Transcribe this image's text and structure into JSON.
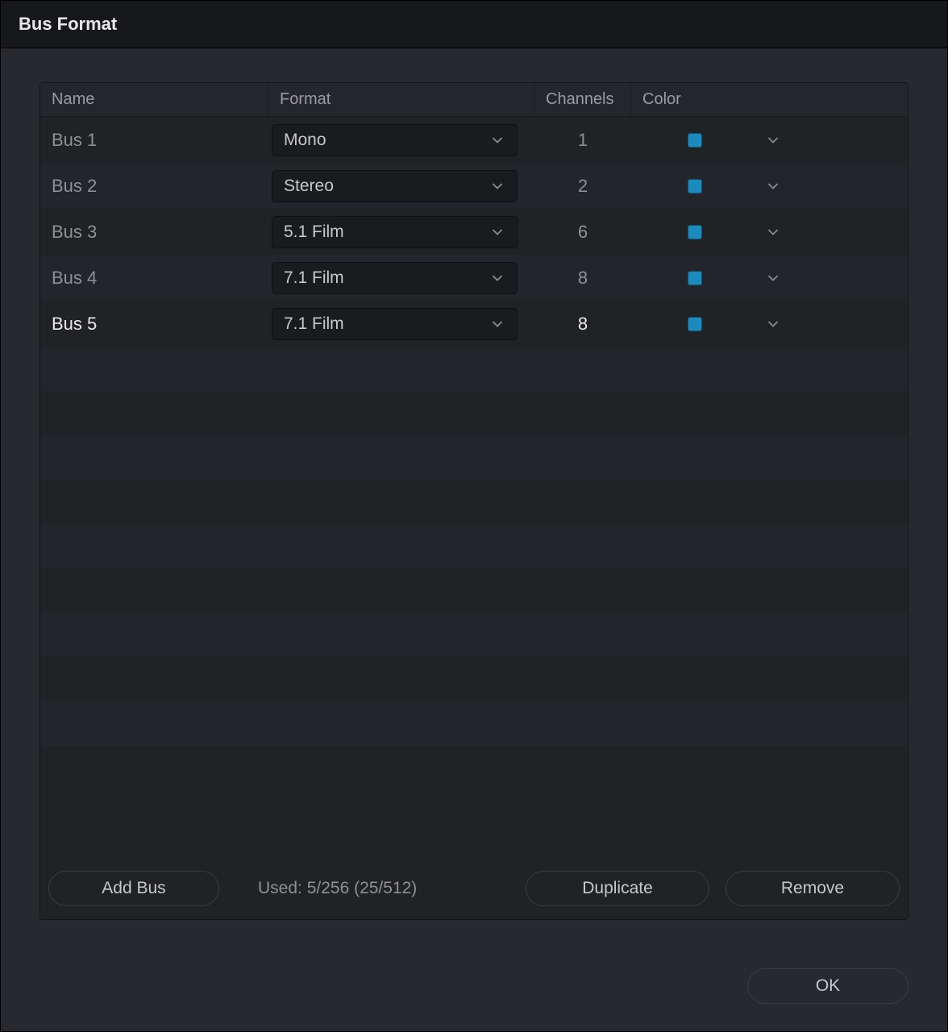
{
  "window": {
    "title": "Bus Format"
  },
  "table": {
    "headers": {
      "name": "Name",
      "format": "Format",
      "channels": "Channels",
      "color": "Color"
    },
    "rows": [
      {
        "name": "Bus 1",
        "format": "Mono",
        "channels": "1",
        "color": "#1b8bbf",
        "selected": false
      },
      {
        "name": "Bus 2",
        "format": "Stereo",
        "channels": "2",
        "color": "#1b8bbf",
        "selected": false
      },
      {
        "name": "Bus 3",
        "format": "5.1 Film",
        "channels": "6",
        "color": "#1b8bbf",
        "selected": false
      },
      {
        "name": "Bus 4",
        "format": "7.1 Film",
        "channels": "8",
        "color": "#1b8bbf",
        "selected": false
      },
      {
        "name": "Bus 5",
        "format": "7.1 Film",
        "channels": "8",
        "color": "#1b8bbf",
        "selected": true
      }
    ]
  },
  "footer": {
    "add_bus": "Add Bus",
    "usage": "Used: 5/256  (25/512)",
    "duplicate": "Duplicate",
    "remove": "Remove"
  },
  "dialog": {
    "ok": "OK"
  },
  "icons": {
    "chevron_down": "chevron-down"
  }
}
